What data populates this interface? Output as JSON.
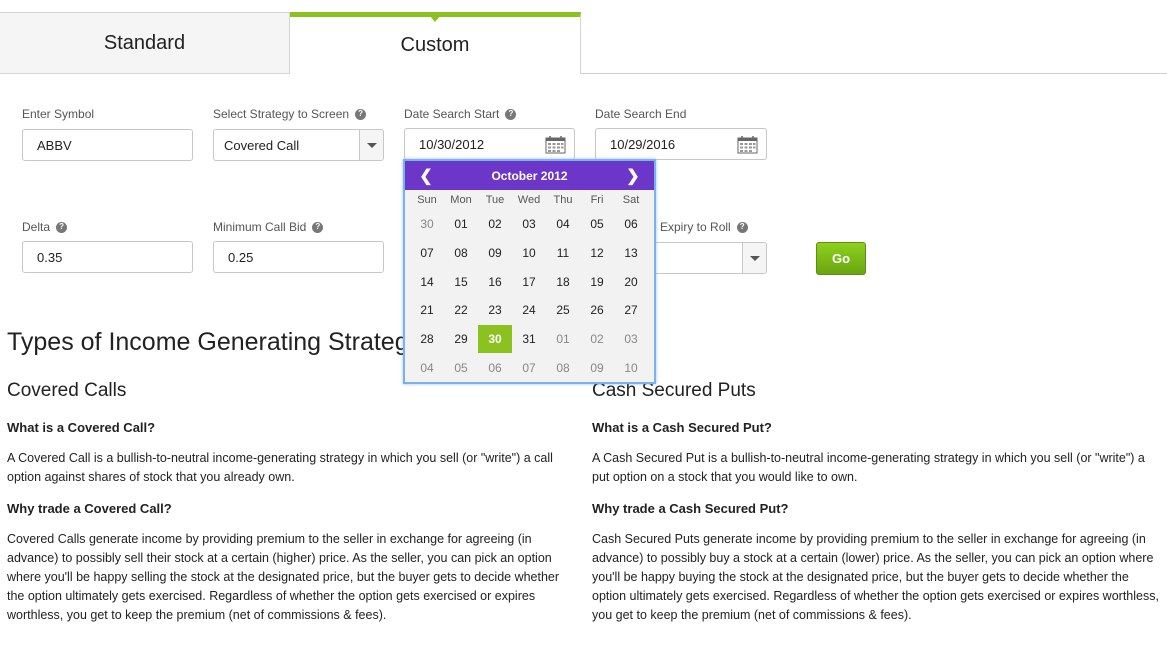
{
  "tabs": [
    {
      "label": "Standard",
      "active": false
    },
    {
      "label": "Custom",
      "active": true
    }
  ],
  "form": {
    "symbol": {
      "label": "Enter Symbol",
      "value": "ABBV"
    },
    "strategy": {
      "label": "Select Strategy to Screen",
      "value": "Covered Call"
    },
    "date_start": {
      "label": "Date Search Start",
      "value": "10/30/2012"
    },
    "date_end": {
      "label": "Date Search End",
      "value": "10/29/2016"
    },
    "delta": {
      "label": "Delta",
      "value": "0.35"
    },
    "min_call_bid": {
      "label": "Minimum Call Bid",
      "value": "0.25"
    },
    "expiry_roll": {
      "label_visible": "e Expiry to Roll",
      "value": ""
    },
    "go_label": "Go"
  },
  "datepicker": {
    "month_label": "October 2012",
    "prev_icon": "chevron-left-icon",
    "next_icon": "chevron-right-icon",
    "dows": [
      "Sun",
      "Mon",
      "Tue",
      "Wed",
      "Thu",
      "Fri",
      "Sat"
    ],
    "days": [
      [
        "30",
        "01",
        "02",
        "03",
        "04",
        "05",
        "06"
      ],
      [
        "07",
        "08",
        "09",
        "10",
        "11",
        "12",
        "13"
      ],
      [
        "14",
        "15",
        "16",
        "17",
        "18",
        "19",
        "20"
      ],
      [
        "21",
        "22",
        "23",
        "24",
        "25",
        "26",
        "27"
      ],
      [
        "28",
        "29",
        "30",
        "31",
        "01",
        "02",
        "03"
      ],
      [
        "04",
        "05",
        "06",
        "07",
        "08",
        "09",
        "10"
      ]
    ],
    "muted_days": [
      [
        0,
        0
      ],
      [
        4,
        4
      ],
      [
        4,
        5
      ],
      [
        4,
        6
      ],
      [
        5,
        0
      ],
      [
        5,
        1
      ],
      [
        5,
        2
      ],
      [
        5,
        3
      ],
      [
        5,
        4
      ],
      [
        5,
        5
      ],
      [
        5,
        6
      ]
    ],
    "selected": [
      4,
      2
    ],
    "header_color": "#6c37c8",
    "selected_color": "#8cc21f"
  },
  "content": {
    "heading": "Types of Income Generating Strateg",
    "left": {
      "title": "Covered Calls",
      "q1": "What is a Covered Call?",
      "a1": "A Covered Call is a bullish-to-neutral income-generating strategy in which you sell (or \"write\") a call option against shares of stock that you already own.",
      "q2": "Why trade a Covered Call?",
      "a2": "Covered Calls generate income by providing premium to the seller in exchange for agreeing (in advance) to possibly sell their stock at a certain (higher) price. As the seller, you can pick an option where you'll be happy selling the stock at the designated price, but the buyer gets to decide whether the option ultimately gets exercised. Regardless of whether the option gets exercised or expires worthless, you get to keep the premium (net of commissions & fees)."
    },
    "right": {
      "title": "Cash Secured Puts",
      "q1": "What is a Cash Secured Put?",
      "a1": "A Cash Secured Put is a bullish-to-neutral income-generating strategy in which you sell (or \"write\") a put option on a stock that you would like to own.",
      "q2": "Why trade a Cash Secured Put?",
      "a2": "Cash Secured Puts generate income by providing premium to the seller in exchange for agreeing (in advance) to possibly buy a stock at a certain (lower) price. As the seller, you can pick an option where you'll be happy buying the stock at the designated price, but the buyer gets to decide whether the option ultimately gets exercised. Regardless of whether the option gets exercised or expires worthless, you get to keep the premium (net of commissions & fees)."
    }
  }
}
